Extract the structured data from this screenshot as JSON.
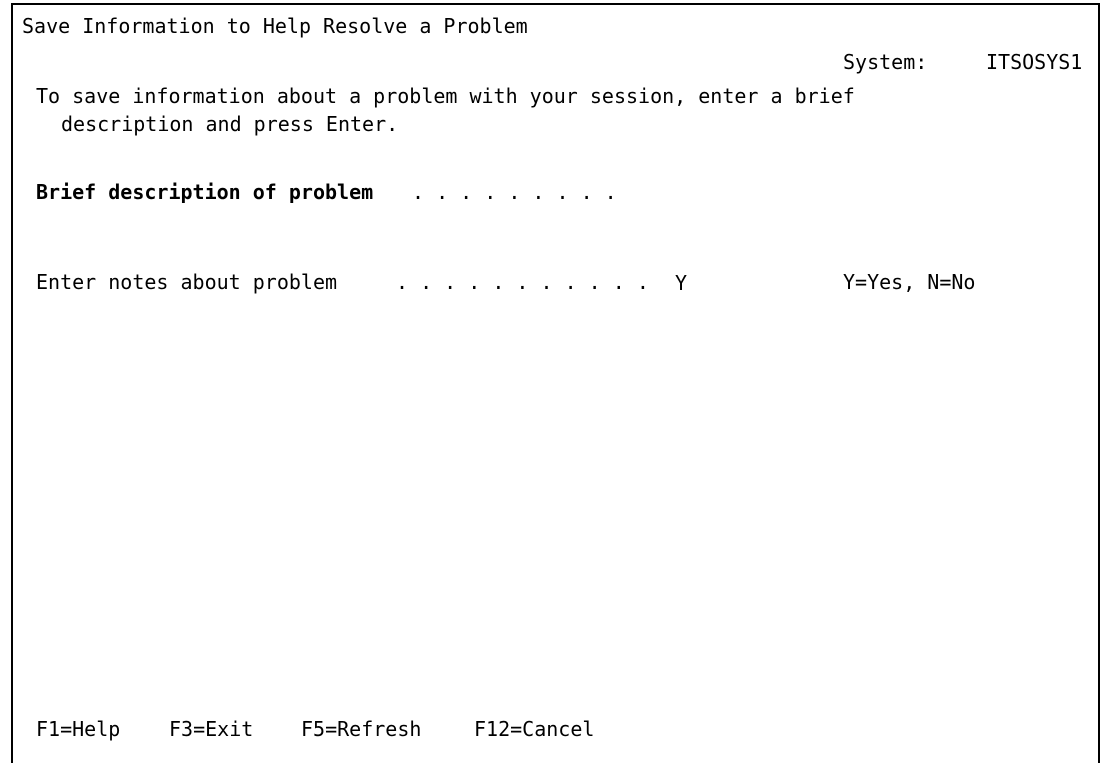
{
  "screen": {
    "title": "Save Information to Help Resolve a Problem",
    "system_label": "System:",
    "system_name": "ITSOSYS1",
    "instruction_line1": "To save information about a problem with your session, enter a brief",
    "instruction_line2": "description and press Enter."
  },
  "fields": {
    "brief_description_label": "Brief description of problem",
    "brief_description_dots": ". . . . . . . . .",
    "brief_description_value": "",
    "notes_label": "Enter notes about problem",
    "notes_dots": ". . . . . . . . . . .",
    "notes_value": "Y",
    "notes_options": "Y=Yes, N=No"
  },
  "function_keys": [
    {
      "label": "F1=Help"
    },
    {
      "label": "F3=Exit"
    },
    {
      "label": "F5=Refresh"
    },
    {
      "label": "F12=Cancel"
    }
  ]
}
